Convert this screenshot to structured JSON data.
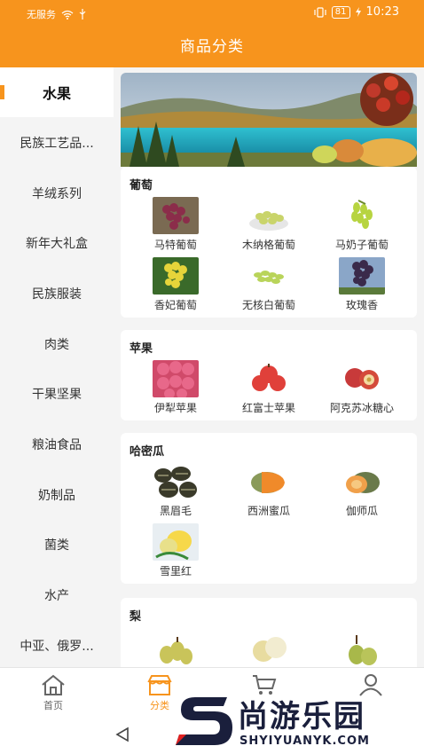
{
  "status": {
    "carrier": "无服务",
    "battery": "81",
    "time": "10:23"
  },
  "header": {
    "title": "商品分类"
  },
  "sidebar": {
    "items": [
      {
        "label": "水果"
      },
      {
        "label": "民族工艺品..."
      },
      {
        "label": "羊绒系列"
      },
      {
        "label": "新年大礼盒"
      },
      {
        "label": "民族服装"
      },
      {
        "label": "肉类"
      },
      {
        "label": "干果坚果"
      },
      {
        "label": "粮油食品"
      },
      {
        "label": "奶制品"
      },
      {
        "label": "菌类"
      },
      {
        "label": "水产"
      },
      {
        "label": "中亚、俄罗..."
      }
    ]
  },
  "sections": [
    {
      "title": "葡萄",
      "products": [
        "马特葡萄",
        "木纳格葡萄",
        "马奶子葡萄",
        "香妃葡萄",
        "无核白葡萄",
        "玫瑰香"
      ]
    },
    {
      "title": "苹果",
      "products": [
        "伊犁苹果",
        "红富士苹果",
        "阿克苏冰糖心"
      ]
    },
    {
      "title": "哈密瓜",
      "products": [
        "黑眉毛",
        "西洲蜜瓜",
        "伽师瓜",
        "雪里红"
      ]
    },
    {
      "title": "梨",
      "products": []
    }
  ],
  "bottom_nav": [
    {
      "label": "首页",
      "icon": "home-icon"
    },
    {
      "label": "分类",
      "icon": "shop-icon"
    },
    {
      "label": "",
      "icon": "cart-icon"
    },
    {
      "label": "",
      "icon": "user-icon"
    }
  ],
  "watermark": {
    "cn": "尚游乐园",
    "en": "SHYIYUANYK.COM"
  },
  "colors": {
    "accent": "#f7941d",
    "sidebar_bg": "#f4f4f4"
  }
}
